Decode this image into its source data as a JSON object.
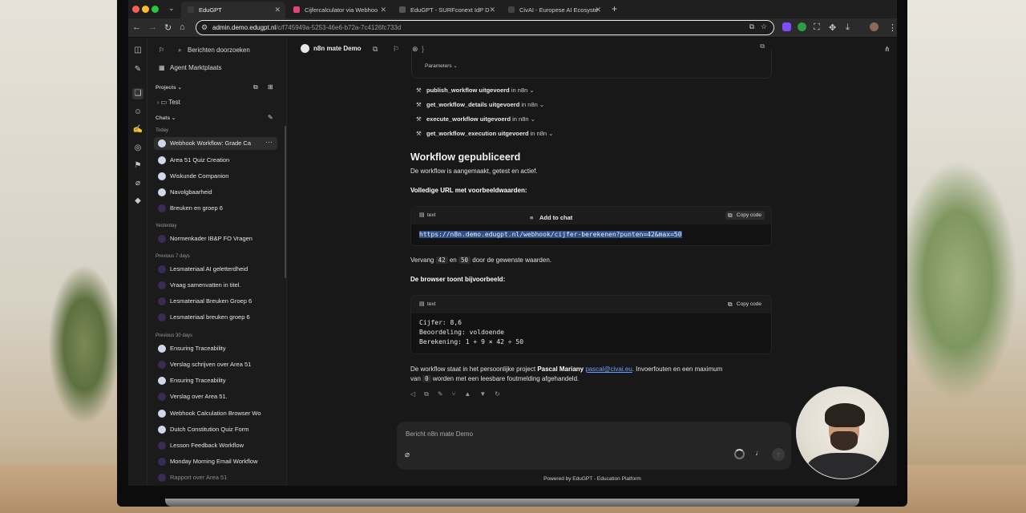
{
  "browser": {
    "tabs": [
      {
        "label": "EduGPT",
        "active": true
      },
      {
        "label": "Cijfercalculator via Webhoo",
        "active": false
      },
      {
        "label": "EduGPT - SURFconext IdP D",
        "active": false
      },
      {
        "label": "CivAI - Europese AI Ecosyste",
        "active": false
      }
    ],
    "new_tab": "+",
    "url_host": "admin.demo.edugpt.nl",
    "url_path": "/c/f745949a-5253-46e6-b72a-7c4126fc733d"
  },
  "sidebar": {
    "search": "Berichten doorzoeken",
    "marketplace": "Agent Marktplaats",
    "projects_label": "Projects",
    "project_item": "Test",
    "chats_label": "Chats",
    "groups": [
      {
        "label": "Today",
        "items": [
          "Webhook Workflow: Grade Ca",
          "Area 51 Quiz Creation",
          "Wiskunde Companion",
          "Navolgbaarheid",
          "Breuken en groep 6"
        ]
      },
      {
        "label": "Yesterday",
        "items": [
          "Normenkader IB&P FO Vragen"
        ]
      },
      {
        "label": "Previous 7 days",
        "items": [
          "Lesmateriaal AI geletterdheid",
          "Vraag samenvatten in titel.",
          "Lesmateriaal Breuken Groep 6",
          "Lesmateriaal breuken groep 6"
        ]
      },
      {
        "label": "Previous 30 days",
        "items": [
          "Ensuring Traceability",
          "Verslag schrijven over Area 51",
          "Ensuring Traceability",
          "Verslag over Area 51.",
          "Webhook Calculation Browser Wo",
          "Dutch Constitution Quiz Form",
          "Lesson Feedback Workflow",
          "Monday Morning Email Workflow",
          "Rapport over Area 51"
        ]
      }
    ]
  },
  "header": {
    "model": "n8n mate Demo"
  },
  "conversation": {
    "parameters_label": "Parameters",
    "tools": [
      {
        "name": "publish_workflow uitgevoerd",
        "in": "in n8n"
      },
      {
        "name": "get_workflow_details uitgevoerd",
        "in": "in n8n"
      },
      {
        "name": "execute_workflow uitgevoerd",
        "in": "in n8n"
      },
      {
        "name": "get_workflow_execution uitgevoerd",
        "in": "in n8n"
      }
    ],
    "heading": "Workflow gepubliceerd",
    "intro": "De workflow is aangemaakt, getest en actief.",
    "url_label": "Volledige URL met voorbeeldwaarden:",
    "code1": {
      "lang": "text",
      "copy": "Copy code",
      "add_to_chat": "Add to chat",
      "content": "https://n8n.demo.edugpt.nl/webhook/cijfer-berekenen?punten=42&max=50"
    },
    "replace_pre": "Vervang",
    "replace_a": "42",
    "replace_mid": "en",
    "replace_b": "50",
    "replace_post": "door de gewenste waarden.",
    "browser_text": "De browser toont bijvoorbeeld:",
    "code2": {
      "lang": "text",
      "copy": "Copy code",
      "lines": [
        "Cijfer: 8,6",
        "Beoordeling: voldoende",
        "Berekening: 1 + 9 × 42 ÷ 50"
      ]
    },
    "closing_1": "De workflow staat in het persoonlijke project",
    "closing_name": "Pascal Mariany",
    "closing_email": "pascal@civai.eu",
    "closing_2": ". Invoerfouten en een maximum",
    "closing_3a": "van",
    "closing_zero": "0",
    "closing_3b": "worden met een leesbare foutmelding afgehandeld."
  },
  "composer": {
    "placeholder": "Bericht n8n mate Demo"
  },
  "footer": "Powered by EduGPT - Education Platform",
  "colors": {
    "accent_link": "#6aa2ff",
    "selection": "#2f4f85",
    "background": "#181818"
  }
}
